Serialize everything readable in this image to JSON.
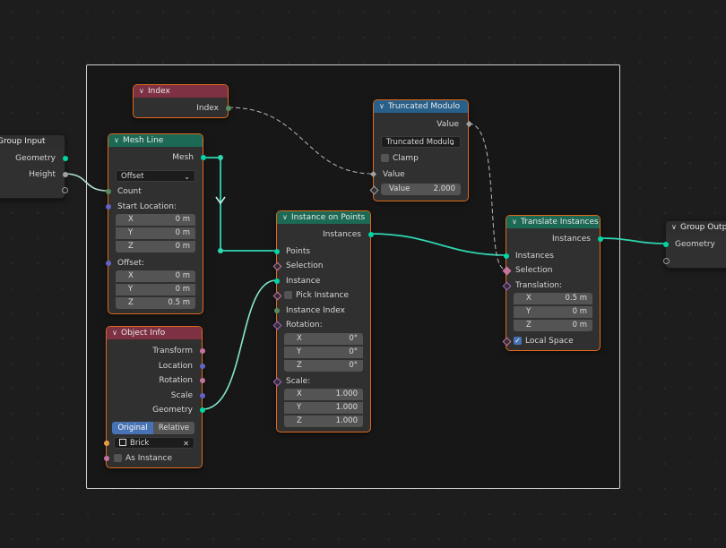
{
  "nodes": {
    "group_input": {
      "title": "Group Input",
      "outputs": [
        "Geometry",
        "Height"
      ]
    },
    "index": {
      "title": "Index",
      "output": "Index"
    },
    "mesh_line": {
      "title": "Mesh Line",
      "output": "Mesh",
      "mode": "Offset",
      "count_label": "Count",
      "start_label": "Start Location:",
      "start": [
        {
          "axis": "X",
          "value": "0 m"
        },
        {
          "axis": "Y",
          "value": "0 m"
        },
        {
          "axis": "Z",
          "value": "0 m"
        }
      ],
      "offset_label": "Offset:",
      "offset": [
        {
          "axis": "X",
          "value": "0 m"
        },
        {
          "axis": "Y",
          "value": "0 m"
        },
        {
          "axis": "Z",
          "value": "0.5 m"
        }
      ]
    },
    "object_info": {
      "title": "Object Info",
      "outputs": [
        "Transform",
        "Location",
        "Rotation",
        "Scale",
        "Geometry"
      ],
      "tab_original": "Original",
      "tab_relative": "Relative",
      "object": "Brick",
      "as_instance": "As Instance"
    },
    "truncated_modulo": {
      "title": "Truncated Modulo",
      "output": "Value",
      "operation": "Truncated Modulo",
      "clamp": "Clamp",
      "input_value": "Value",
      "value_label": "Value",
      "value": "2.000"
    },
    "instance_on_points": {
      "title": "Instance on Points",
      "output": "Instances",
      "points": "Points",
      "selection": "Selection",
      "instance": "Instance",
      "pick_instance": "Pick Instance",
      "instance_index": "Instance Index",
      "rotation_label": "Rotation:",
      "rotation": [
        {
          "axis": "X",
          "value": "0°"
        },
        {
          "axis": "Y",
          "value": "0°"
        },
        {
          "axis": "Z",
          "value": "0°"
        }
      ],
      "scale_label": "Scale:",
      "scale": [
        {
          "axis": "X",
          "value": "1.000"
        },
        {
          "axis": "Y",
          "value": "1.000"
        },
        {
          "axis": "Z",
          "value": "1.000"
        }
      ]
    },
    "translate_instances": {
      "title": "Translate Instances",
      "output": "Instances",
      "instances": "Instances",
      "selection": "Selection",
      "translation_label": "Translation:",
      "translation": [
        {
          "axis": "X",
          "value": "0.5 m"
        },
        {
          "axis": "Y",
          "value": "0 m"
        },
        {
          "axis": "Z",
          "value": "0 m"
        }
      ],
      "local_space": "Local Space"
    },
    "group_output": {
      "title": "Group Output",
      "input": "Geometry"
    }
  },
  "colors": {
    "geometry_socket": "#00d6a3",
    "input_header": "#7e3142",
    "geometry_header": "#1c6a55",
    "utility_header": "#28608a",
    "selected_border": "#e0691a"
  }
}
